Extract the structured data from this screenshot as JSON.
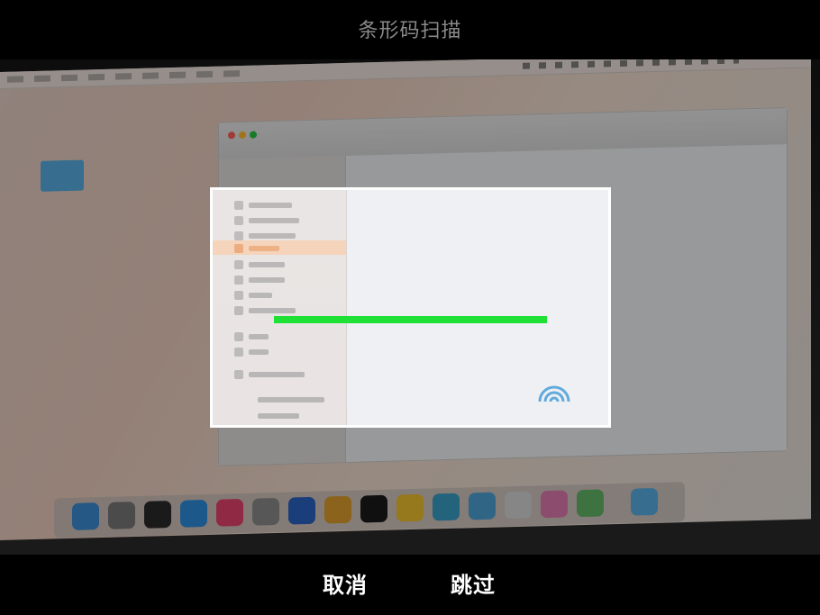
{
  "header": {
    "title": "条形码扫描"
  },
  "actions": {
    "cancel_label": "取消",
    "skip_label": "跳过"
  },
  "colors": {
    "scan_line": "#1fe034",
    "frame_border": "#ffffff",
    "background": "#000000",
    "title_text": "#8a8a8a"
  },
  "icons": {
    "airdrop": "airdrop-icon",
    "folder": "folder-icon"
  }
}
